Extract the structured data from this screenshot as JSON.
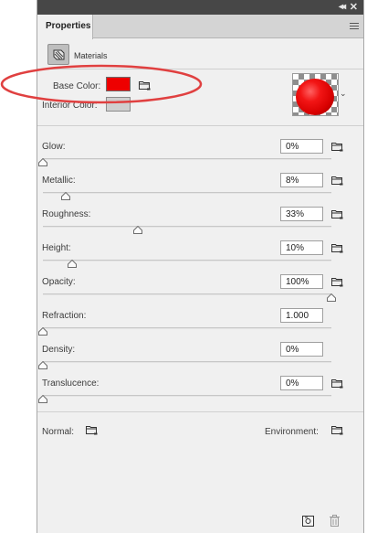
{
  "panel": {
    "tab_label": "Properties",
    "collapse_glyph": "◂◂",
    "close_glyph": "✕",
    "section_label": "Materials"
  },
  "colors": {
    "base_color_label": "Base Color:",
    "base_color_value": "#ee0000",
    "interior_color_label": "Interior Color:",
    "interior_color_value": "#cfcfcf",
    "preview_dropdown_glyph": "⌄"
  },
  "properties": [
    {
      "name": "Glow:",
      "value": "0%",
      "level": 0.0,
      "has_folder": true
    },
    {
      "name": "Metallic:",
      "value": "8%",
      "level": 0.08,
      "has_folder": true
    },
    {
      "name": "Roughness:",
      "value": "33%",
      "level": 0.33,
      "has_folder": true
    },
    {
      "name": "Height:",
      "value": "10%",
      "level": 0.1,
      "has_folder": true
    },
    {
      "name": "Opacity:",
      "value": "100%",
      "level": 1.0,
      "has_folder": true
    },
    {
      "name": "Refraction:",
      "value": "1.000",
      "level": 0.0,
      "has_folder": false
    },
    {
      "name": "Density:",
      "value": "0%",
      "level": 0.0,
      "has_folder": false
    },
    {
      "name": "Translucence:",
      "value": "0%",
      "level": 0.0,
      "has_folder": true
    }
  ],
  "maps": {
    "normal_label": "Normal:",
    "environment_label": "Environment:"
  },
  "icons": {
    "folder": "folder-icon",
    "materials": "materials-icon",
    "menu": "panel-menu-icon",
    "reset": "reset-icon",
    "trash": "trash-icon"
  },
  "annotation": {
    "highlight_color": "#e04040"
  }
}
